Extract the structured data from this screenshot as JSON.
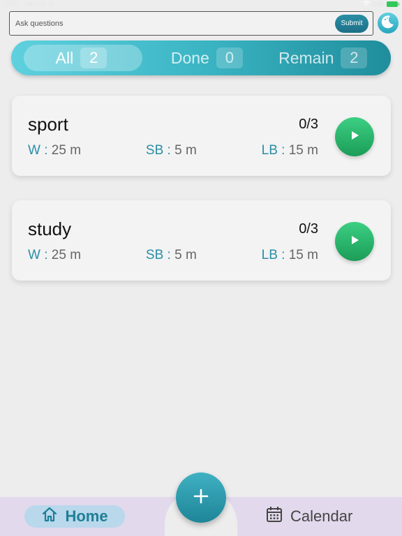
{
  "status_bar": {
    "time": "10:24",
    "date": "Mon Apr 29",
    "battery": "64%"
  },
  "ask": {
    "placeholder": "Ask questions",
    "submit_label": "Submit"
  },
  "filters": [
    {
      "label": "All",
      "count": "2",
      "active": true
    },
    {
      "label": "Done",
      "count": "0",
      "active": false
    },
    {
      "label": "Remain",
      "count": "2",
      "active": false
    }
  ],
  "tasks": [
    {
      "name": "sport",
      "progress": "0/3",
      "work_key": "W",
      "work_value": "25 m",
      "short_break_key": "SB",
      "short_break_value": "5 m",
      "long_break_key": "LB",
      "long_break_value": "15 m"
    },
    {
      "name": "study",
      "progress": "0/3",
      "work_key": "W",
      "work_value": "25 m",
      "short_break_key": "SB",
      "short_break_value": "5 m",
      "long_break_key": "LB",
      "long_break_value": "15 m"
    }
  ],
  "nav": {
    "home_label": "Home",
    "calendar_label": "Calendar"
  },
  "colors": {
    "accent": "#2a8ea6",
    "play": "#22b066",
    "nav_bg": "#e2d9ec"
  }
}
